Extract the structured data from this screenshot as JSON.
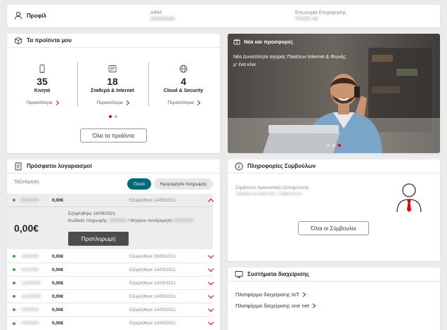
{
  "profile": {
    "title": "Προφίλ",
    "afm_label": "ΑΦΜ",
    "afm_value": "000000000",
    "company_label": "Επωνυμία Επιχείρησης",
    "company_value": "ΠΟΙΟΣ ΑΕ"
  },
  "products": {
    "title": "Τα προϊόντα μου",
    "items": [
      {
        "count": "35",
        "label": "Κινητά",
        "more": "Περισσότερα",
        "icon": "mobile-phone-icon"
      },
      {
        "count": "18",
        "label": "Σταθερά & Internet",
        "more": "Περισσότερα",
        "icon": "landline-icon"
      },
      {
        "count": "4",
        "label": "Cloud & Security",
        "more": "Περισσότερα",
        "icon": "globe-icon"
      }
    ],
    "all_button": "Όλα τα προϊόντα"
  },
  "offers": {
    "title": "Νέα και προσφορές",
    "text": "Νέα Δυνατότητα αγοράς Πακέτων Internet & Φωνής μ' ένα κλικ"
  },
  "bills": {
    "title": "Πρόσφατοι λογαριασμοί",
    "sort_label": "Ταξινόμηση",
    "sort_amount": "Ποσό",
    "sort_date": "Ημερομηνία πληρωμής",
    "expanded": {
      "number": "0000000",
      "amount": "0,00€",
      "paid": "Εξοφλήθηκε 14/09/2021",
      "big_amount": "0,00€",
      "paid_line": "Εξοφλήθηκε 14/09/2021",
      "code_label": "Κωδικός πληρωμής:",
      "code_value": "0000000",
      "registry_label": "/ Μητρώο συνδρομητή:",
      "registry_value": "00000000",
      "prepay_button": "Προπληρωμή"
    },
    "rows": [
      {
        "number": "1000000",
        "amount": "0,00€",
        "paid": "Εξοφλήθηκε 09/09/2021"
      },
      {
        "number": "1100000",
        "amount": "0,00€",
        "paid": "Εξοφλήθηκε 14/09/2021"
      },
      {
        "number": "11100000",
        "amount": "0,00€",
        "paid": "Εξοφλήθηκε 14/09/2021"
      },
      {
        "number": "11100000",
        "amount": "0,00€",
        "paid": "Εξοφλήθηκε 14/09/2021"
      },
      {
        "number": "1000000",
        "amount": "0,00€",
        "paid": "Εξοφλήθηκε 14/09/2021"
      },
      {
        "number": "1000000",
        "amount": "0,00€",
        "paid": "Εξοφλήθηκε 14/09/2021"
      }
    ]
  },
  "advisors": {
    "title": "Πληροφορίες Συμβούλων",
    "role": "Σύμβουλος προσωπικής εξυπηρέτησης",
    "name": "ΟΝΟΜΑΤΕΠΩΝΥΜΟ ΣΥΜΒΟΥΛΟΥ",
    "all_button": "Όλοι οι Σύμβουλοι"
  },
  "systems": {
    "title": "Συστήματα διαχείρισης",
    "links": [
      "Πλατφόρμα διαχείρισης IoT",
      "Πλατφόρμα διαχείρισης one net"
    ]
  },
  "colors": {
    "accent": "#e60000",
    "teal": "#00697c",
    "green": "#43a047"
  }
}
